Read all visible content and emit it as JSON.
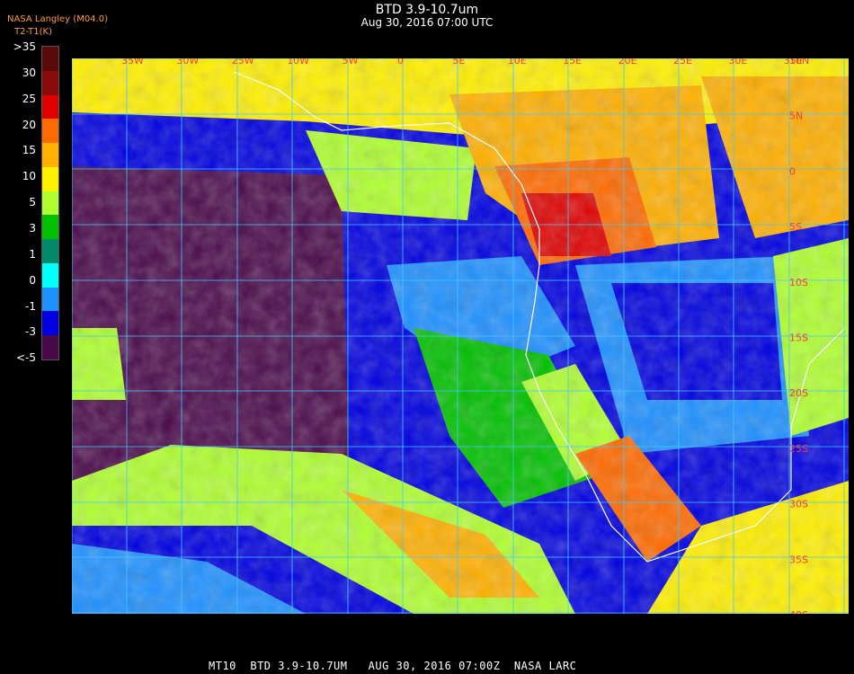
{
  "header": {
    "title": "BTD 3.9-10.7um",
    "datetime": "Aug 30, 2016 07:00 UTC",
    "credit": "NASA Langley (M04.0)",
    "units": "T2-T1(K)"
  },
  "legend": {
    "labels": [
      ">35",
      "30",
      "25",
      "20",
      "15",
      "10",
      "5",
      "3",
      "1",
      "0",
      "-1",
      "-3",
      "<-5"
    ],
    "colors": [
      "#5a0a0a",
      "#8b0a0a",
      "#e00000",
      "#ff6a00",
      "#ffb000",
      "#fff000",
      "#b0ff30",
      "#00c000",
      "#008a6a",
      "#00ffff",
      "#1e90ff",
      "#0000e0",
      "#4a0a4a"
    ]
  },
  "map": {
    "lon_labels": [
      "35W",
      "30W",
      "25W",
      "10W",
      "5W",
      "0",
      "5E",
      "10E",
      "15E",
      "20E",
      "25E",
      "30E",
      "35E"
    ],
    "lat_labels": [
      "10N",
      "5N",
      "0",
      "5S",
      "10S",
      "15S",
      "20S",
      "25S",
      "30S",
      "35S",
      "40S"
    ],
    "grid_color": "#40c8ff"
  },
  "footer": {
    "text": "MT10  BTD 3.9-10.7UM   AUG 30, 2016 07:00Z  NASA LARC"
  }
}
